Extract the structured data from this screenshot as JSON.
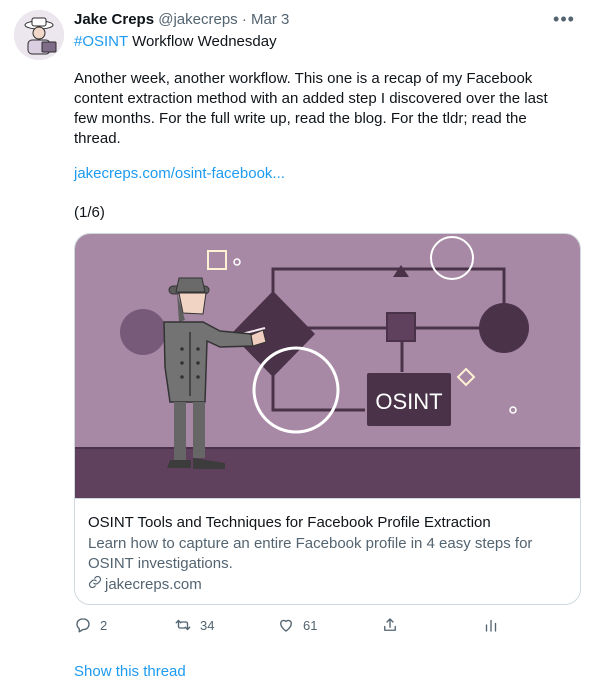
{
  "tweet": {
    "author_name": "Jake Creps",
    "handle": "@jakecreps",
    "separator": "·",
    "date": "Mar 3",
    "hashtag": "#OSINT",
    "title_rest": " Workflow Wednesday",
    "body": "Another week, another workflow. This one is a recap of my Facebook content extraction method with an added step I discovered over the last few months. For the full write up, read the blog. For the tldr; read the thread.",
    "link": "jakecreps.com/osint-facebook...",
    "thread_counter": "(1/6)"
  },
  "card": {
    "image_badge": "OSINT",
    "title": "OSINT Tools and Techniques for Facebook Profile Extraction",
    "description": "Learn how to capture an entire Facebook profile in 4 easy steps for OSINT investigations.",
    "domain": "jakecreps.com"
  },
  "actions": {
    "replies": "2",
    "retweets": "34",
    "likes": "61"
  },
  "icons": {
    "more": "more-icon",
    "reply": "reply-icon",
    "retweet": "retweet-icon",
    "like": "heart-icon",
    "share": "share-icon",
    "analytics": "analytics-icon",
    "link": "link-icon"
  },
  "footer": {
    "show_thread": "Show this thread"
  },
  "colors": {
    "accent": "#1d9bf0",
    "muted": "#536471",
    "card_background": "#a789a5",
    "card_dark": "#4a3248"
  }
}
